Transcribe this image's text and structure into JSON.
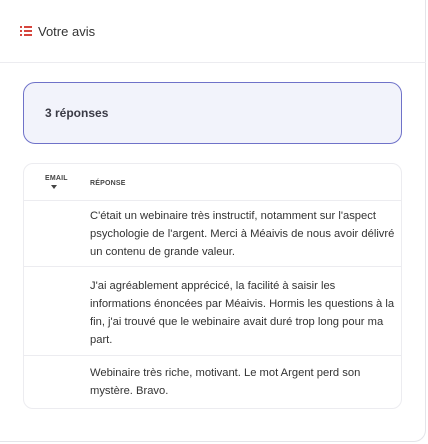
{
  "header": {
    "icon": "list-icon",
    "title": "Votre avis",
    "accent": "#d6453d"
  },
  "summary": {
    "count_label": "3 réponses",
    "border_color": "#6f72c9"
  },
  "table": {
    "columns": [
      "EMAIL",
      "RÉPONSE"
    ],
    "rows": [
      {
        "email": "",
        "reponse": "C'était un webinaire très instructif, notamment sur l'aspect psychologie de l'argent. Merci à Méaivis de nous avoir délivré un contenu de grande valeur."
      },
      {
        "email": "",
        "reponse": "J'ai agréablement apprécicé, la facilité à saisir les informations énoncées par Méaivis. Hormis les questions à la fin, j'ai trouvé que le webinaire avait duré trop long pour ma part."
      },
      {
        "email": "",
        "reponse": "Webinaire très riche, motivant. Le mot Argent perd son mystère. Bravo."
      }
    ]
  }
}
